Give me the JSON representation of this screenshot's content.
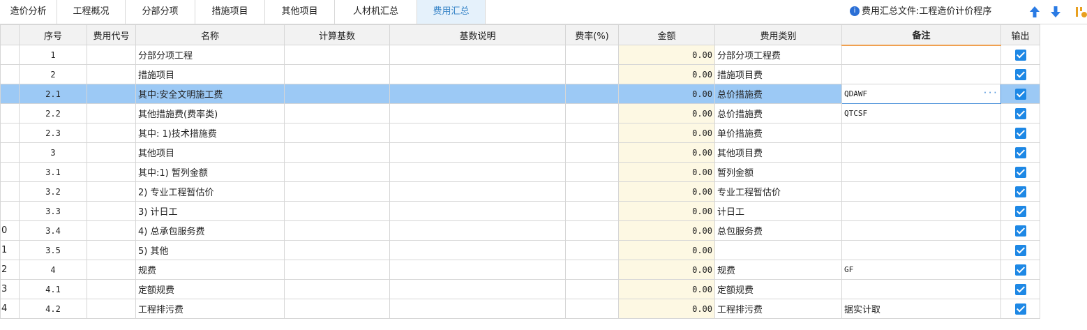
{
  "tabs": [
    {
      "label": "造价分析",
      "active": false
    },
    {
      "label": "工程概况",
      "active": false
    },
    {
      "label": "分部分项",
      "active": false
    },
    {
      "label": "措施项目",
      "active": false
    },
    {
      "label": "其他项目",
      "active": false
    },
    {
      "label": "人材机汇总",
      "active": false
    },
    {
      "label": "费用汇总",
      "active": true
    }
  ],
  "file_indicator": {
    "label": "费用汇总文件:工程造价计价程序"
  },
  "columns": [
    "序号",
    "费用代号",
    "名称",
    "计算基数",
    "基数说明",
    "费率(%)",
    "金额",
    "费用类别",
    "备注",
    "输出"
  ],
  "rows": [
    {
      "rn": "",
      "seq": "1",
      "code": "",
      "name": "分部分项工程",
      "base": "",
      "desc": "",
      "rate": "",
      "amount": "0.00",
      "type": "分部分项工程费",
      "remark": "",
      "out": true
    },
    {
      "rn": "",
      "seq": "2",
      "code": "",
      "name": "措施项目",
      "base": "",
      "desc": "",
      "rate": "",
      "amount": "0.00",
      "type": "措施项目费",
      "remark": "",
      "out": true
    },
    {
      "rn": "",
      "seq": "2.1",
      "code": "",
      "name": "其中:安全文明施工费",
      "base": "",
      "desc": "",
      "rate": "",
      "amount": "0.00",
      "type": "总价措施费",
      "remark": "QDAWF",
      "out": true,
      "selected": true
    },
    {
      "rn": "",
      "seq": "2.2",
      "code": "",
      "name": "其他措施费(费率类)",
      "base": "",
      "desc": "",
      "rate": "",
      "amount": "0.00",
      "type": "总价措施费",
      "remark": "QTCSF",
      "out": true
    },
    {
      "rn": "",
      "seq": "2.3",
      "code": "",
      "name": "其中: 1)技术措施费",
      "base": "",
      "desc": "",
      "rate": "",
      "amount": "0.00",
      "type": "单价措施费",
      "remark": "",
      "out": true
    },
    {
      "rn": "",
      "seq": "3",
      "code": "",
      "name": "其他项目",
      "base": "",
      "desc": "",
      "rate": "",
      "amount": "0.00",
      "type": "其他项目费",
      "remark": "",
      "out": true
    },
    {
      "rn": "",
      "seq": "3.1",
      "code": "",
      "name": "其中:1) 暂列金额",
      "base": "",
      "desc": "",
      "rate": "",
      "amount": "0.00",
      "type": "暂列金额",
      "remark": "",
      "out": true
    },
    {
      "rn": "",
      "seq": "3.2",
      "code": "",
      "name": "2) 专业工程暂估价",
      "base": "",
      "desc": "",
      "rate": "",
      "amount": "0.00",
      "type": "专业工程暂估价",
      "remark": "",
      "out": true
    },
    {
      "rn": "",
      "seq": "3.3",
      "code": "",
      "name": "3) 计日工",
      "base": "",
      "desc": "",
      "rate": "",
      "amount": "0.00",
      "type": "计日工",
      "remark": "",
      "out": true
    },
    {
      "rn": "0",
      "seq": "3.4",
      "code": "",
      "name": "4) 总承包服务费",
      "base": "",
      "desc": "",
      "rate": "",
      "amount": "0.00",
      "type": "总包服务费",
      "remark": "",
      "out": true
    },
    {
      "rn": "1",
      "seq": "3.5",
      "code": "",
      "name": "5) 其他",
      "base": "",
      "desc": "",
      "rate": "",
      "amount": "0.00",
      "type": "",
      "remark": "",
      "out": true
    },
    {
      "rn": "2",
      "seq": "4",
      "code": "",
      "name": "规费",
      "base": "",
      "desc": "",
      "rate": "",
      "amount": "0.00",
      "type": "规费",
      "remark": "GF",
      "out": true
    },
    {
      "rn": "3",
      "seq": "4.1",
      "code": "",
      "name": "定额规费",
      "base": "",
      "desc": "",
      "rate": "",
      "amount": "0.00",
      "type": "定额规费",
      "remark": "",
      "out": true
    },
    {
      "rn": "4",
      "seq": "4.2",
      "code": "",
      "name": "工程排污费",
      "base": "",
      "desc": "",
      "rate": "",
      "amount": "0.00",
      "type": "工程排污费",
      "remark": "据实计取",
      "out": true
    }
  ],
  "colors": {
    "accent": "#1e88e5",
    "selected_row": "#9cc9f5",
    "amount_bg": "#fdf8e3",
    "active_tab": "#e5f1fb"
  },
  "icons": [
    "info-icon",
    "arrow-up-icon",
    "arrow-down-icon",
    "checkbox-checked-icon",
    "ellipsis-icon"
  ]
}
